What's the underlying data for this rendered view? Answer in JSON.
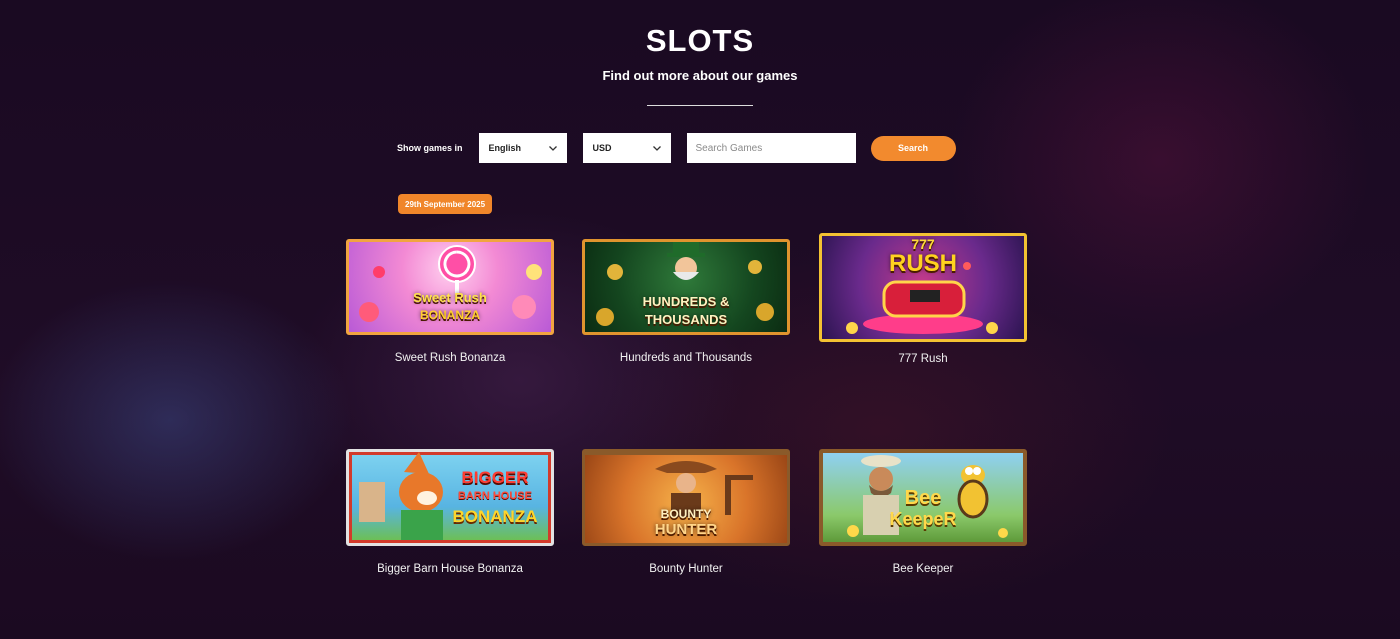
{
  "header": {
    "title": "SLOTS",
    "subtitle": "Find out more about our games"
  },
  "filters": {
    "label": "Show games in",
    "language": "English",
    "currency": "USD",
    "search_placeholder": "Search Games",
    "search_button": "Search"
  },
  "date_badge": "29th September 2025",
  "games": [
    {
      "name": "Sweet Rush Bonanza",
      "logo": [
        "Sweet Rush",
        "BONANZA"
      ]
    },
    {
      "name": "Hundreds and Thousands",
      "logo": [
        "HUNDREDS &",
        "THOUSANDS"
      ]
    },
    {
      "name": "777 Rush",
      "logo": [
        "777",
        "RUSH"
      ]
    },
    {
      "name": "Bigger Barn House Bonanza",
      "logo": [
        "BIGGER",
        "BARN HOUSE",
        "BONANZA"
      ]
    },
    {
      "name": "Bounty Hunter",
      "logo": [
        "BOUNTY",
        "HUNTER"
      ]
    },
    {
      "name": "Bee Keeper",
      "logo": [
        "Bee",
        "KeepeR"
      ]
    }
  ],
  "colors": {
    "accent": "#f28a2e",
    "background": "#1d0b24"
  }
}
